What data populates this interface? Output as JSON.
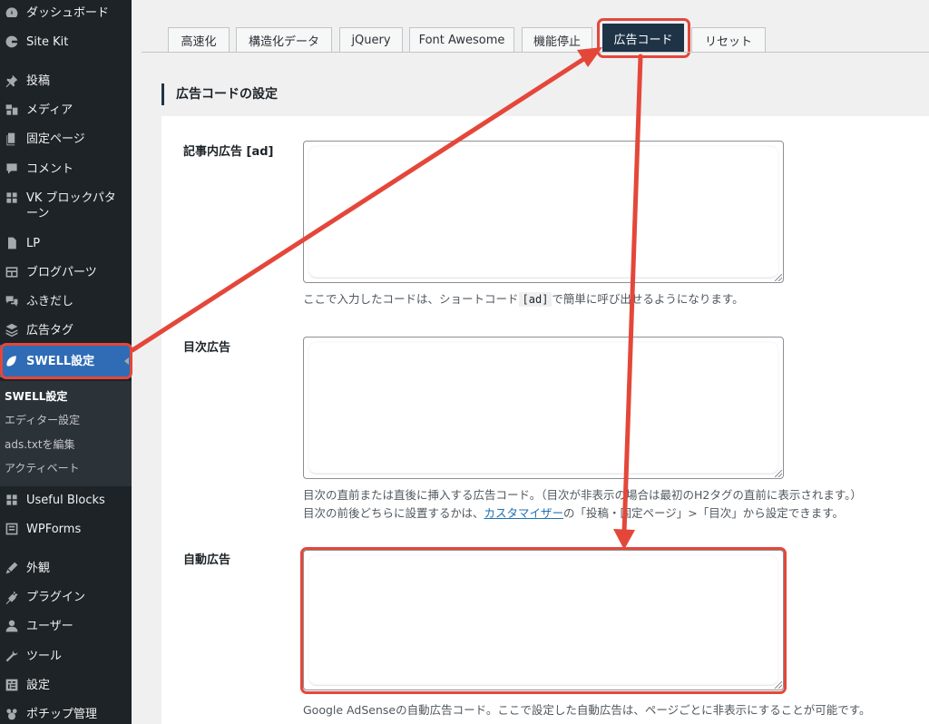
{
  "sidebar": {
    "items": [
      {
        "label": "ダッシュボード",
        "icon": "dashboard-icon"
      },
      {
        "label": "Site Kit",
        "icon": "site-kit-icon"
      },
      {
        "label": "投稿",
        "icon": "pin-icon"
      },
      {
        "label": "メディア",
        "icon": "media-icon"
      },
      {
        "label": "固定ページ",
        "icon": "page-icon"
      },
      {
        "label": "コメント",
        "icon": "comment-icon"
      },
      {
        "label": "VK ブロックパタ\nーン",
        "icon": "grid-icon"
      },
      {
        "label": "LP",
        "icon": "document-icon"
      },
      {
        "label": "ブログパーツ",
        "icon": "layout-icon"
      },
      {
        "label": "ふきだし",
        "icon": "speech-bubbles-icon"
      },
      {
        "label": "広告タグ",
        "icon": "stack-icon"
      },
      {
        "label": "SWELL設定",
        "icon": "swell-icon"
      },
      {
        "label": "Useful Blocks",
        "icon": "blocks-icon"
      },
      {
        "label": "WPForms",
        "icon": "form-icon"
      },
      {
        "label": "外観",
        "icon": "appearance-icon"
      },
      {
        "label": "プラグイン",
        "icon": "plugin-icon"
      },
      {
        "label": "ユーザー",
        "icon": "user-icon"
      },
      {
        "label": "ツール",
        "icon": "wrench-icon"
      },
      {
        "label": "設定",
        "icon": "settings-icon"
      },
      {
        "label": "ポチップ管理",
        "icon": "pochipp-icon"
      }
    ],
    "submenu": [
      "SWELL設定",
      "エディター設定",
      "ads.txtを編集",
      "アクティベート"
    ]
  },
  "tabs": [
    "高速化",
    "構造化データ",
    "jQuery",
    "Font Awesome",
    "機能停止",
    "広告コード",
    "リセット"
  ],
  "active_tab": "広告コード",
  "section_title": "広告コードの設定",
  "fields": {
    "article_ad": {
      "label": "記事内広告 [ad]",
      "value": "",
      "desc_pre": "ここで入力したコードは、ショートコード",
      "desc_code": "[ad]",
      "desc_post": "で簡単に呼び出せるようになります。"
    },
    "toc_ad": {
      "label": "目次広告",
      "value": "",
      "desc_line1": "目次の直前または直後に挿入する広告コード。（目次が非表示の場合は最初のH2タグの直前に表示されます。）",
      "desc_line2_pre": "目次の前後どちらに設置するかは、",
      "desc_line2_link": "カスタマイザー",
      "desc_line2_post": "の「投稿・固定ページ」>「目次」から設定できます。"
    },
    "auto_ad": {
      "label": "自動広告",
      "value": "",
      "desc": "Google AdSenseの自動広告コード。ここで設定した自動広告は、ページごとに非表示にすることが可能です。"
    }
  },
  "colors": {
    "annotation": "#e4473a",
    "sidebar_bg": "#1d2327",
    "active_menu": "#2f6cb5",
    "active_tab": "#1f3347",
    "marker": "#fcedb0"
  }
}
